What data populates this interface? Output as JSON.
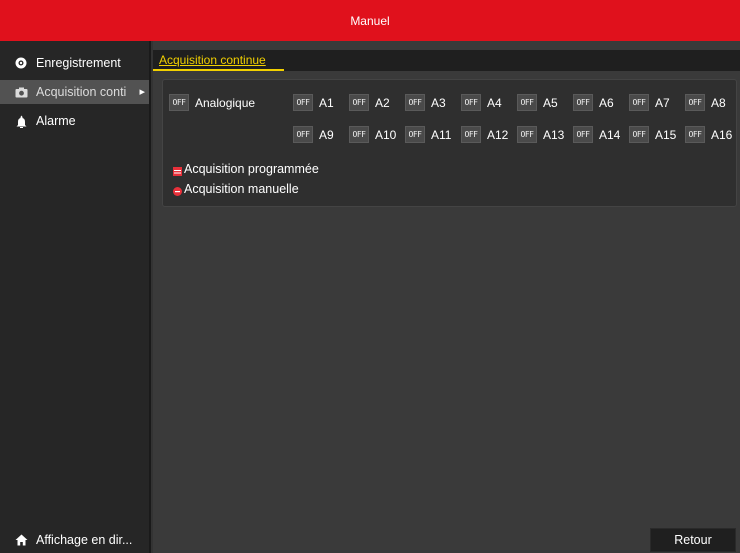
{
  "window": {
    "title": "Manuel"
  },
  "sidebar": {
    "items": [
      {
        "label": "Enregistrement",
        "icon": "record-icon"
      },
      {
        "label": "Acquisition conti",
        "icon": "camera-icon",
        "active": true
      },
      {
        "label": "Alarme",
        "icon": "alarm-icon"
      }
    ],
    "bottom": {
      "label": "Affichage en dir...",
      "icon": "home-icon"
    }
  },
  "tabs": [
    {
      "label": "Acquisition continue"
    }
  ],
  "panel": {
    "all_toggle": {
      "state": "OFF",
      "label": "Analogique"
    },
    "channels_row1": [
      {
        "state": "OFF",
        "label": "A1"
      },
      {
        "state": "OFF",
        "label": "A2"
      },
      {
        "state": "OFF",
        "label": "A3"
      },
      {
        "state": "OFF",
        "label": "A4"
      },
      {
        "state": "OFF",
        "label": "A5"
      },
      {
        "state": "OFF",
        "label": "A6"
      },
      {
        "state": "OFF",
        "label": "A7"
      },
      {
        "state": "OFF",
        "label": "A8"
      }
    ],
    "channels_row2": [
      {
        "state": "OFF",
        "label": "A9"
      },
      {
        "state": "OFF",
        "label": "A10"
      },
      {
        "state": "OFF",
        "label": "A11"
      },
      {
        "state": "OFF",
        "label": "A12"
      },
      {
        "state": "OFF",
        "label": "A13"
      },
      {
        "state": "OFF",
        "label": "A14"
      },
      {
        "state": "OFF",
        "label": "A15"
      },
      {
        "state": "OFF",
        "label": "A16"
      }
    ],
    "legend": [
      {
        "label": "Acquisition programmée",
        "color": "#e8303a"
      },
      {
        "label": "Acquisition manuelle",
        "color": "#e8303a"
      }
    ]
  },
  "footer": {
    "back_label": "Retour"
  },
  "colors": {
    "accent": "#e0111c",
    "tab_active": "#f2d000"
  }
}
